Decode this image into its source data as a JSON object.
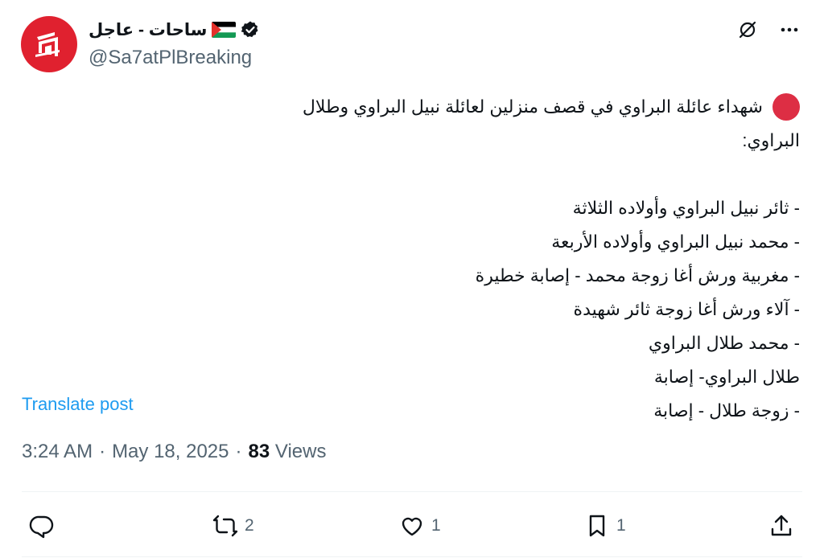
{
  "author": {
    "display_name": "ساحات - عاجل",
    "handle": "@Sa7atPlBreaking",
    "flag_icon": "palestine-flag-icon",
    "verified_icon": "verified-badge-icon",
    "avatar_color": "#e0212f"
  },
  "post": {
    "lines": [
      "شهداء عائلة البراوي في قصف منزلين لعائلة نبيل البراوي وطلال",
      "البراوي:",
      "",
      "- ثائر نبيل البراوي وأولاده الثلاثة",
      "- محمد نبيل البراوي وأولاده الأربعة",
      "- مغربية ورش أغا زوجة محمد - إصابة خطيرة",
      "- آلاء ورش أغا زوجة ثائر شهيدة",
      "- محمد طلال البراوي",
      "طلال البراوي- إصابة",
      "- زوجة طلال - إصابة"
    ],
    "bullet_icon": "red-circle-icon"
  },
  "translate_label": "Translate post",
  "meta": {
    "time": "3:24 AM",
    "date": "May 18, 2025",
    "views_count": "83",
    "views_label": "Views",
    "separator": "·"
  },
  "actions": {
    "reply_count": "",
    "repost_count": "2",
    "like_count": "1",
    "bookmark_count": "1"
  },
  "colors": {
    "accent": "#1d9bf0",
    "secondary_text": "#536471",
    "red_bullet": "#dd2e44"
  }
}
